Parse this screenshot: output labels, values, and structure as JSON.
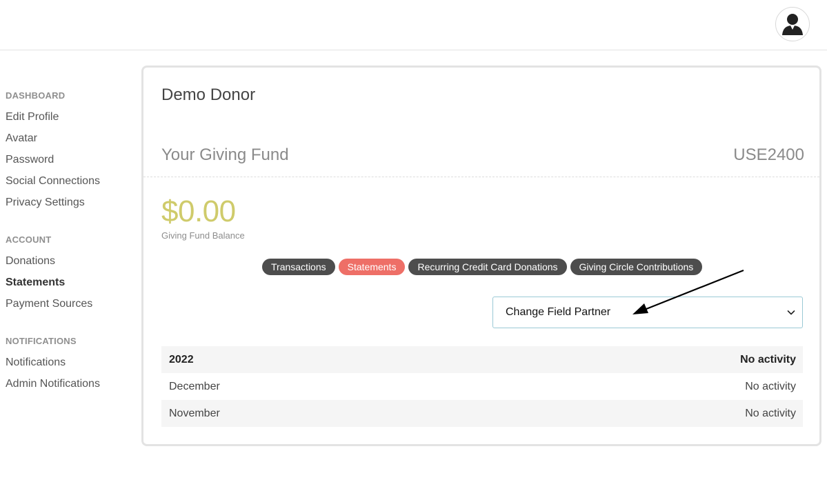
{
  "sidebar": {
    "sections": [
      {
        "heading": "DASHBOARD",
        "items": [
          "Edit Profile",
          "Avatar",
          "Password",
          "Social Connections",
          "Privacy Settings"
        ]
      },
      {
        "heading": "ACCOUNT",
        "items": [
          "Donations",
          "Statements",
          "Payment Sources"
        ]
      },
      {
        "heading": "NOTIFICATIONS",
        "items": [
          "Notifications",
          "Admin Notifications"
        ]
      }
    ],
    "active_item": "Statements"
  },
  "card": {
    "donor_name": "Demo Donor",
    "fund_title": "Your Giving Fund",
    "fund_id": "USE2400",
    "balance": "$0.00",
    "balance_label": "Giving Fund Balance"
  },
  "tabs": [
    {
      "label": "Transactions",
      "active": false
    },
    {
      "label": "Statements",
      "active": true
    },
    {
      "label": "Recurring Credit Card Donations",
      "active": false
    },
    {
      "label": "Giving Circle Contributions",
      "active": false
    }
  ],
  "field_partner_select": {
    "value": "Change Field Partner",
    "icon": "chevron-down-icon"
  },
  "statements_table": {
    "header": {
      "year": "2022",
      "status": "No activity"
    },
    "rows": [
      {
        "month": "December",
        "status": "No activity"
      },
      {
        "month": "November",
        "status": "No activity"
      }
    ]
  },
  "colors": {
    "balance": "#cfcb6b",
    "tab_active": "#ee6f67",
    "tab_inactive": "#4d4d4d",
    "select_border": "#9ac9d5"
  }
}
